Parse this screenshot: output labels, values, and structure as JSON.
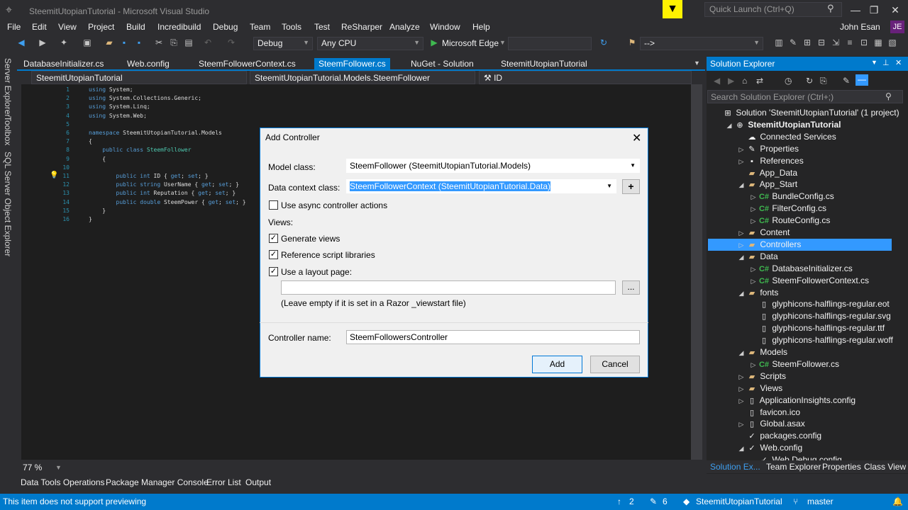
{
  "window": {
    "title": "SteemitUtopianTutorial - Microsoft Visual Studio",
    "quick_launch_placeholder": "Quick Launch (Ctrl+Q)",
    "user": "John Esan",
    "user_initials": "JE"
  },
  "menu": [
    "File",
    "Edit",
    "View",
    "Project",
    "Build",
    "Incredibuild",
    "Debug",
    "Team",
    "Tools",
    "Test",
    "ReSharper",
    "Analyze",
    "Window",
    "Help"
  ],
  "toolbar": {
    "config": "Debug",
    "platform": "Any CPU",
    "run_target": "Microsoft Edge",
    "extra_combo": "-->"
  },
  "left_rail": [
    "Server Explorer",
    "Toolbox",
    "SQL Server Object Explorer"
  ],
  "tabs": [
    "DatabaseInitializer.cs",
    "Web.config",
    "SteemFollowerContext.cs",
    "SteemFollower.cs",
    "NuGet - Solution",
    "SteemitUtopianTutorial"
  ],
  "active_tab": "SteemFollower.cs",
  "navbar": {
    "project": "SteemitUtopianTutorial",
    "type": "SteemitUtopianTutorial.Models.SteemFollower",
    "member": "ID"
  },
  "code_lines": [
    {
      "n": "1",
      "html": "<span class='kw'>using</span> System;"
    },
    {
      "n": "2",
      "html": "<span class='kw'>using</span> System.Collections.Generic;"
    },
    {
      "n": "3",
      "html": "<span class='kw'>using</span> System.Linq;"
    },
    {
      "n": "4",
      "html": "<span class='kw'>using</span> System.Web;"
    },
    {
      "n": "5",
      "html": ""
    },
    {
      "n": "6",
      "html": "<span class='kw'>namespace</span> SteemitUtopianTutorial.Models"
    },
    {
      "n": "7",
      "html": "{"
    },
    {
      "n": "8",
      "html": "    <span class='kw'>public class</span> <span class='ty'>SteemFollower</span>"
    },
    {
      "n": "9",
      "html": "    {"
    },
    {
      "n": "10",
      "html": ""
    },
    {
      "n": "11",
      "html": "        <span class='kw'>public int</span> ID { <span class='kw'>get</span>; <span class='kw'>set</span>; }"
    },
    {
      "n": "12",
      "html": "        <span class='kw'>public string</span> UserName { <span class='kw'>get</span>; <span class='kw'>set</span>; }"
    },
    {
      "n": "13",
      "html": "        <span class='kw'>public int</span> Reputation { <span class='kw'>get</span>; <span class='kw'>set</span>; }"
    },
    {
      "n": "14",
      "html": "        <span class='kw'>public double</span> SteemPower { <span class='kw'>get</span>; <span class='kw'>set</span>; }"
    },
    {
      "n": "15",
      "html": "    }"
    },
    {
      "n": "16",
      "html": "}"
    }
  ],
  "zoom": "77 %",
  "bottom_tabs": [
    "Data Tools Operations",
    "Package Manager Console",
    "Error List",
    "Output"
  ],
  "status": {
    "message": "This item does not support previewing",
    "up_count": "2",
    "edit_count": "6",
    "project": "SteemitUtopianTutorial",
    "branch": "master"
  },
  "solution_explorer": {
    "title": "Solution Explorer",
    "search_placeholder": "Search Solution Explorer (Ctrl+;)",
    "nodes": [
      {
        "label": "Solution 'SteemitUtopianTutorial' (1 project)",
        "indent": 0,
        "exp": "",
        "icon": "solution"
      },
      {
        "label": "SteemitUtopianTutorial",
        "indent": 1,
        "exp": "◢",
        "icon": "project",
        "bold": true
      },
      {
        "label": "Connected Services",
        "indent": 2,
        "exp": "",
        "icon": "cloud"
      },
      {
        "label": "Properties",
        "indent": 2,
        "exp": "▷",
        "icon": "wrench"
      },
      {
        "label": "References",
        "indent": 2,
        "exp": "▷",
        "icon": "refs"
      },
      {
        "label": "App_Data",
        "indent": 2,
        "exp": "",
        "icon": "folder"
      },
      {
        "label": "App_Start",
        "indent": 2,
        "exp": "◢",
        "icon": "folder"
      },
      {
        "label": "BundleConfig.cs",
        "indent": 3,
        "exp": "▷",
        "icon": "cs"
      },
      {
        "label": "FilterConfig.cs",
        "indent": 3,
        "exp": "▷",
        "icon": "cs"
      },
      {
        "label": "RouteConfig.cs",
        "indent": 3,
        "exp": "▷",
        "icon": "cs"
      },
      {
        "label": "Content",
        "indent": 2,
        "exp": "▷",
        "icon": "folder"
      },
      {
        "label": "Controllers",
        "indent": 2,
        "exp": "▷",
        "icon": "folder",
        "selected": true
      },
      {
        "label": "Data",
        "indent": 2,
        "exp": "◢",
        "icon": "folder"
      },
      {
        "label": "DatabaseInitializer.cs",
        "indent": 3,
        "exp": "▷",
        "icon": "cs"
      },
      {
        "label": "SteemFollowerContext.cs",
        "indent": 3,
        "exp": "▷",
        "icon": "cs"
      },
      {
        "label": "fonts",
        "indent": 2,
        "exp": "◢",
        "icon": "folder"
      },
      {
        "label": "glyphicons-halflings-regular.eot",
        "indent": 3,
        "exp": "",
        "icon": "file"
      },
      {
        "label": "glyphicons-halflings-regular.svg",
        "indent": 3,
        "exp": "",
        "icon": "file"
      },
      {
        "label": "glyphicons-halflings-regular.ttf",
        "indent": 3,
        "exp": "",
        "icon": "file"
      },
      {
        "label": "glyphicons-halflings-regular.woff",
        "indent": 3,
        "exp": "",
        "icon": "file"
      },
      {
        "label": "Models",
        "indent": 2,
        "exp": "◢",
        "icon": "folder"
      },
      {
        "label": "SteemFollower.cs",
        "indent": 3,
        "exp": "▷",
        "icon": "cs"
      },
      {
        "label": "Scripts",
        "indent": 2,
        "exp": "▷",
        "icon": "folder"
      },
      {
        "label": "Views",
        "indent": 2,
        "exp": "▷",
        "icon": "folder"
      },
      {
        "label": "ApplicationInsights.config",
        "indent": 2,
        "exp": "▷",
        "icon": "file"
      },
      {
        "label": "favicon.ico",
        "indent": 2,
        "exp": "",
        "icon": "file"
      },
      {
        "label": "Global.asax",
        "indent": 2,
        "exp": "▷",
        "icon": "file"
      },
      {
        "label": "packages.config",
        "indent": 2,
        "exp": "",
        "icon": "config"
      },
      {
        "label": "Web.config",
        "indent": 2,
        "exp": "◢",
        "icon": "config"
      },
      {
        "label": "Web.Debug.config",
        "indent": 3,
        "exp": "",
        "icon": "config"
      }
    ],
    "tabs": [
      "Solution Ex...",
      "Team Explorer",
      "Properties",
      "Class View"
    ]
  },
  "dialog": {
    "title": "Add Controller",
    "model_class_label": "Model class:",
    "model_class_value": "SteemFollower (SteemitUtopianTutorial.Models)",
    "data_context_label": "Data context class:",
    "data_context_value": "SteemFollowerContext (SteemitUtopianTutorial.Data)",
    "add_context_button": "+",
    "async_label": "Use async controller actions",
    "async_checked": false,
    "views_heading": "Views:",
    "generate_views_label": "Generate views",
    "generate_views_checked": true,
    "ref_scripts_label": "Reference script libraries",
    "ref_scripts_checked": true,
    "layout_label": "Use a layout page:",
    "layout_checked": true,
    "layout_value": "",
    "browse_button": "...",
    "layout_hint": "(Leave empty if it is set in a Razor _viewstart file)",
    "controller_name_label": "Controller name:",
    "controller_name_value": "SteemFollowersController",
    "add_button": "Add",
    "cancel_button": "Cancel"
  }
}
